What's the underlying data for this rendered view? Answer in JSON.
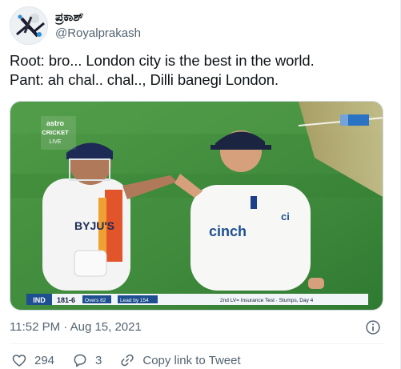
{
  "tweet": {
    "display_name": "ಪ್ರಕಾಶ್",
    "handle": "@Royalprakash",
    "lines": [
      "Root: bro... London city is the best in the world.",
      "Pant: ah chal.. chal.., Dilli banegi London."
    ],
    "timestamp": "11:52 PM · Aug 15, 2021"
  },
  "media": {
    "watermark_line1": "astro",
    "watermark_line2": "CRICKET",
    "watermark_line3": "LIVE",
    "jersey_left": "BYJU'S",
    "jersey_right": "cinch",
    "jersey_right_sleeve": "ci",
    "scorebar": {
      "team": "IND",
      "score": "181-6",
      "overs": "Overs 82",
      "lead": "Lead by 154",
      "match": "2nd LV= Insurance Test · Stumps, Day 4"
    }
  },
  "actions": {
    "likes": "294",
    "replies": "3",
    "copy_link": "Copy link to Tweet"
  },
  "icons": [
    "avatar",
    "info-icon",
    "heart-icon",
    "reply-icon",
    "link-icon"
  ],
  "colors": {
    "text": "#0f1419",
    "muted": "#536471",
    "grass": "#3f8a3c",
    "scorebar_blue": "#1d4f91"
  }
}
